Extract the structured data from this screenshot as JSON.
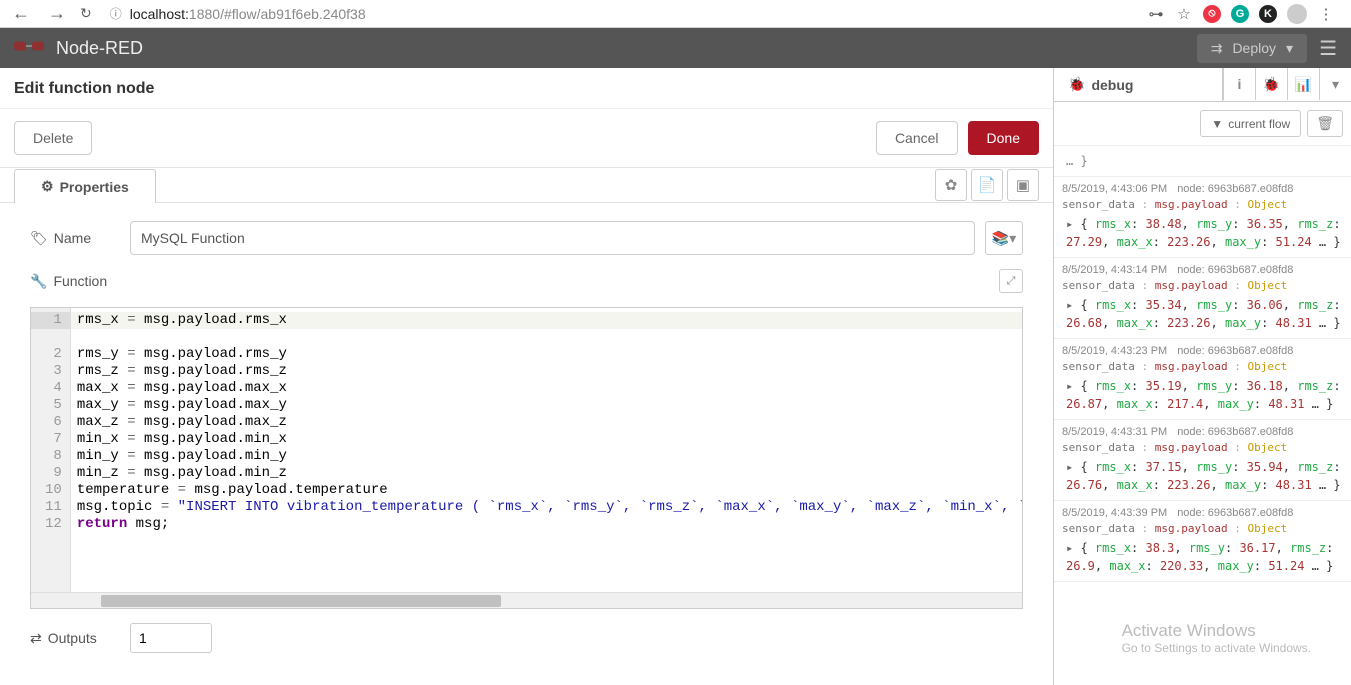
{
  "browser": {
    "url_host": "localhost:",
    "url_port": "1880",
    "url_path": "/#flow/ab91f6eb.240f38"
  },
  "header": {
    "brand": "Node-RED",
    "deploy_label": "Deploy"
  },
  "editor": {
    "title": "Edit function node",
    "delete_label": "Delete",
    "cancel_label": "Cancel",
    "done_label": "Done",
    "tab_properties": "Properties",
    "name_label": "Name",
    "name_value": "MySQL Function",
    "function_label": "Function",
    "outputs_label": "Outputs",
    "outputs_value": "1",
    "code": {
      "lines": [
        "rms_x = msg.payload.rms_x",
        "rms_y = msg.payload.rms_y",
        "rms_z = msg.payload.rms_z",
        "max_x = msg.payload.max_x",
        "max_y = msg.payload.max_y",
        "max_z = msg.payload.max_z",
        "min_x = msg.payload.min_x",
        "min_y = msg.payload.min_y",
        "min_z = msg.payload.min_z",
        "temperature = msg.payload.temperature",
        "msg.topic = \"INSERT INTO vibration_temperature ( `rms_x`, `rms_y`, `rms_z`, `max_x`, `max_y`, `max_z`, `min_x`, `min_y`, `m",
        "return msg;"
      ]
    }
  },
  "sidebar": {
    "debug_tab": "debug",
    "filter_label": "current flow",
    "messages": [
      {
        "time": "8/5/2019, 4:43:06 PM",
        "node": "node: 6963b687.e08fd8",
        "src": "sensor_data",
        "payload_path": "msg.payload",
        "type": "Object",
        "rms_x": "38.48",
        "rms_y": "36.35",
        "rms_z": "27.29",
        "max_x": "223.26",
        "max_y": "51.24"
      },
      {
        "time": "8/5/2019, 4:43:14 PM",
        "node": "node: 6963b687.e08fd8",
        "src": "sensor_data",
        "payload_path": "msg.payload",
        "type": "Object",
        "rms_x": "35.34",
        "rms_y": "36.06",
        "rms_z": "26.68",
        "max_x": "223.26",
        "max_y": "48.31"
      },
      {
        "time": "8/5/2019, 4:43:23 PM",
        "node": "node: 6963b687.e08fd8",
        "src": "sensor_data",
        "payload_path": "msg.payload",
        "type": "Object",
        "rms_x": "35.19",
        "rms_y": "36.18",
        "rms_z": "26.87",
        "max_x": "217.4",
        "max_y": "48.31"
      },
      {
        "time": "8/5/2019, 4:43:31 PM",
        "node": "node: 6963b687.e08fd8",
        "src": "sensor_data",
        "payload_path": "msg.payload",
        "type": "Object",
        "rms_x": "37.15",
        "rms_y": "35.94",
        "rms_z": "26.76",
        "max_x": "223.26",
        "max_y": "48.31"
      },
      {
        "time": "8/5/2019, 4:43:39 PM",
        "node": "node: 6963b687.e08fd8",
        "src": "sensor_data",
        "payload_path": "msg.payload",
        "type": "Object",
        "rms_x": "38.3",
        "rms_y": "36.17",
        "rms_z": "26.9",
        "max_x": "220.33",
        "max_y": "51.24"
      }
    ]
  },
  "watermark": {
    "l1": "Activate Windows",
    "l2": "Go to Settings to activate Windows."
  }
}
